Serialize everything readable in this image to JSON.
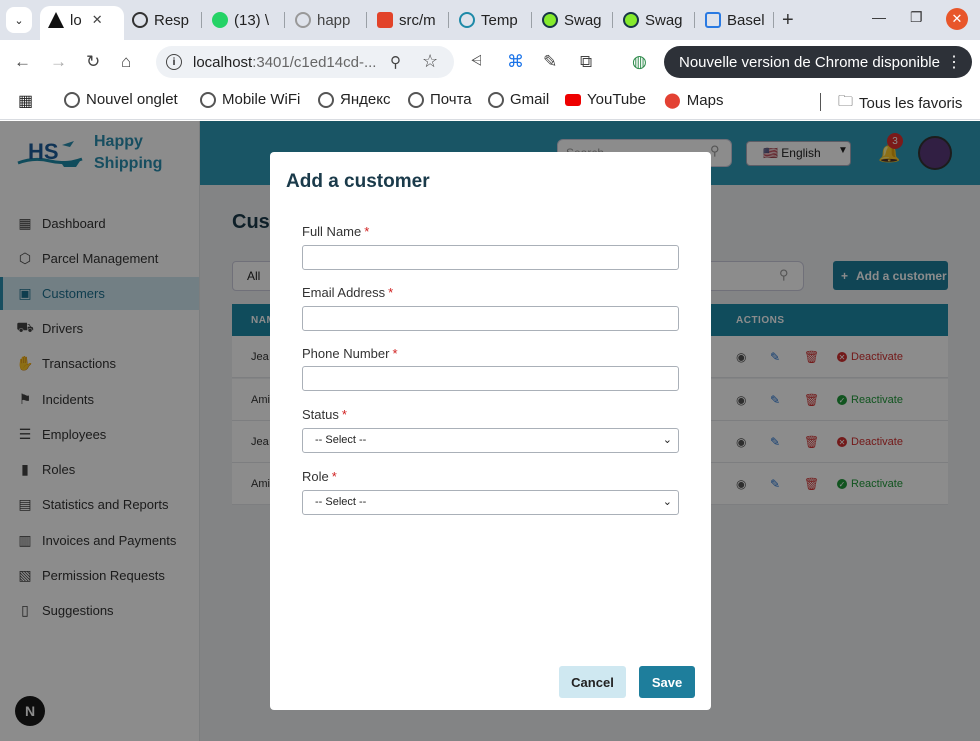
{
  "browser": {
    "tabs": [
      {
        "label": "lo",
        "favicon": "app-icon",
        "active": true
      },
      {
        "label": "Resp",
        "favicon": "openai-icon"
      },
      {
        "label": "(13) \\",
        "favicon": "whatsapp-icon"
      },
      {
        "label": "happ",
        "favicon": "globe-icon"
      },
      {
        "label": "src/m",
        "favicon": "gitlab-icon"
      },
      {
        "label": "Temp",
        "favicon": "app-icon"
      },
      {
        "label": "Swag",
        "favicon": "swagger-icon"
      },
      {
        "label": "Swag",
        "favicon": "swagger-icon"
      },
      {
        "label": "Basel",
        "favicon": "bike-icon"
      }
    ],
    "url_host": "localhost",
    "url_rest": ":3401/c1ed14cd-...",
    "update_notice": "Nouvelle version de Chrome disponible",
    "bookmarks": [
      "Nouvel onglet",
      "Mobile WiFi",
      "Яндекс",
      "Почта",
      "Gmail",
      "YouTube",
      "Maps"
    ],
    "all_bookmarks": "Tous les favoris"
  },
  "app": {
    "brand": {
      "line1": "Happy",
      "line2": "Shipping"
    },
    "nav": [
      {
        "label": "Dashboard",
        "icon": "grid-icon"
      },
      {
        "label": "Parcel Management",
        "icon": "box-icon"
      },
      {
        "label": "Customers",
        "icon": "contact-card-icon",
        "active": true
      },
      {
        "label": "Drivers",
        "icon": "truck-icon"
      },
      {
        "label": "Transactions",
        "icon": "hand-coin-icon"
      },
      {
        "label": "Incidents",
        "icon": "flag-icon"
      },
      {
        "label": "Employees",
        "icon": "user-list-icon"
      },
      {
        "label": "Roles",
        "icon": "bookmark-icon"
      },
      {
        "label": "Statistics and Reports",
        "icon": "chart-doc-icon"
      },
      {
        "label": "Invoices and Payments",
        "icon": "clipboard-icon"
      },
      {
        "label": "Permission Requests",
        "icon": "doc-chart-icon"
      },
      {
        "label": "Suggestions",
        "icon": "doc-icon"
      }
    ],
    "next_badge": "N",
    "header": {
      "search_placeholder": "Search",
      "language": "🇺🇸 English",
      "notifications": "3"
    },
    "page_title": "Cust",
    "filter": "All",
    "add_button": "Add a customer",
    "table": {
      "headers": {
        "name": "NAM",
        "actions": "ACTIONS"
      },
      "rows": [
        {
          "name": "Jea",
          "status": "Deactivate",
          "status_color": "#d23030"
        },
        {
          "name": "Ami",
          "status": "Reactivate",
          "status_color": "#1f9a3a"
        },
        {
          "name": "Jea",
          "status": "Deactivate",
          "status_color": "#d23030"
        },
        {
          "name": "Ami",
          "status": "Reactivate",
          "status_color": "#1f9a3a"
        }
      ]
    }
  },
  "modal": {
    "title": "Add a customer",
    "fields": {
      "full_name": {
        "label": "Full Name",
        "value": ""
      },
      "email": {
        "label": "Email Address",
        "value": ""
      },
      "phone": {
        "label": "Phone Number",
        "value": ""
      },
      "status": {
        "label": "Status",
        "selected": "-- Select --"
      },
      "role": {
        "label": "Role",
        "selected": "-- Select --"
      }
    },
    "required_mark": "*",
    "cancel": "Cancel",
    "save": "Save"
  }
}
